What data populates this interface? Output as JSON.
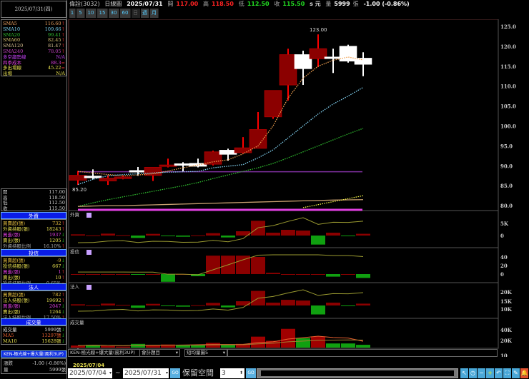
{
  "left": {
    "date": "2025/07/31(四)",
    "ma": [
      {
        "label": "SMA5",
        "value": "116.60",
        "color": "#e8a060",
        "arrow": "↑"
      },
      {
        "label": "SMA10",
        "value": "109.66",
        "color": "#7ad0f0",
        "arrow": "↑"
      },
      {
        "label": "SMA20",
        "value": "99.41",
        "color": "#30c030",
        "arrow": "↑"
      },
      {
        "label": "SMA60",
        "value": "82.45",
        "color": "#d8c070",
        "arrow": "↑"
      },
      {
        "label": "SMA120",
        "value": "81.47",
        "color": "#d8c090",
        "arrow": "↑"
      },
      {
        "label": "SMA240",
        "value": "78.05",
        "color": "#c040c0",
        "arrow": "↑"
      },
      {
        "label": "多空趨勢線",
        "value": "N/A",
        "color": "#c040f0",
        "arrow": ""
      },
      {
        "label": "四季成本",
        "value": "88.3",
        "color": "#e040e0",
        "arrow": "="
      },
      {
        "label": "多出場線",
        "value": "45.22",
        "color": "#e8e050",
        "arrow": "="
      },
      {
        "label": "出場",
        "value": "N/A",
        "color": "#e8e050",
        "arrow": ""
      }
    ],
    "ohlc": [
      {
        "label": "開",
        "value": "117.00"
      },
      {
        "label": "高",
        "value": "118.50"
      },
      {
        "label": "低",
        "value": "112.50"
      },
      {
        "label": "收",
        "value": "115.50"
      }
    ],
    "foreign": {
      "title": "外資",
      "rows": [
        {
          "label": "買賣超(張)",
          "value": "732",
          "color": "#e8c040",
          "arrow": "↑"
        },
        {
          "label": "外資持股(張)",
          "value": "18243",
          "color": "#e8e050",
          "arrow": "↑"
        },
        {
          "label": "買進(張)",
          "value": "1937",
          "color": "#e040e0",
          "arrow": "↓"
        },
        {
          "label": "賣出(張)",
          "value": "1205",
          "color": "#e8e050",
          "arrow": "↓"
        },
        {
          "label": "外資持股比例",
          "value": "16.10%",
          "color": "#aaa",
          "arrow": "↑"
        }
      ]
    },
    "trust": {
      "title": "投信",
      "rows": [
        {
          "label": "買賣超(張)",
          "value": "-9",
          "color": "#e8c040",
          "arrow": "↓"
        },
        {
          "label": "投信持股(張)",
          "value": "667",
          "color": "#e8e050",
          "arrow": "↓"
        },
        {
          "label": "買進(張)",
          "value": "1",
          "color": "#e040e0",
          "arrow": "↑"
        },
        {
          "label": "賣出(張)",
          "value": "10",
          "color": "#e8e050",
          "arrow": "↑"
        },
        {
          "label": "投信持股比例",
          "value": "0.65%",
          "color": "#aaa",
          "arrow": "="
        }
      ]
    },
    "inst": {
      "title": "法人",
      "rows": [
        {
          "label": "買賣超(張)",
          "value": "782",
          "color": "#e8c040",
          "arrow": "↑"
        },
        {
          "label": "法人持股(張)",
          "value": "19692",
          "color": "#e8e050",
          "arrow": "↑"
        },
        {
          "label": "買進(張)",
          "value": "2047",
          "color": "#e040e0",
          "arrow": "↓"
        },
        {
          "label": "賣出(張)",
          "value": "1264",
          "color": "#e8e050",
          "arrow": "↓"
        },
        {
          "label": "法人持股比例",
          "value": "17.50%",
          "color": "#aaa",
          "arrow": "↑"
        }
      ]
    },
    "volume": {
      "title": "成交量",
      "rows": [
        {
          "label": "成交量",
          "value": "5999張",
          "color": "#ddd",
          "arrow": "↓"
        },
        {
          "label": "MA5",
          "value": "13297張",
          "color": "#e86030",
          "arrow": "↓"
        },
        {
          "label": "MA10",
          "value": "15628張",
          "color": "#e8e050",
          "arrow": "↓"
        }
      ]
    },
    "indicator": "KEN-極光線+爆大量(風利3UP)",
    "change": {
      "label": "漲跌",
      "value": "-1.00 (-0.86%)"
    },
    "vol": {
      "label": "量",
      "value": "5999張"
    }
  },
  "header": {
    "name": "偉詮(3032)",
    "period": "日線圖",
    "date": "2025/07/31",
    "open_label": "開",
    "open": "117.00",
    "high_label": "高",
    "high": "118.50",
    "low_label": "低",
    "low": "112.50",
    "close_label": "收",
    "close": "115.50",
    "unit": "s 元",
    "vol_label": "量",
    "vol": "5999",
    "vol_unit": "張",
    "change": "-1.00 (-0.86%)"
  },
  "periods": [
    "1",
    "5",
    "10",
    "15",
    "30",
    "60",
    "日",
    "週",
    "月"
  ],
  "panels": {
    "foreign": "外資",
    "trust": "投信",
    "inst": "法人",
    "volume": "成交量"
  },
  "bottom": {
    "indicator": "KEN-極光線+爆大量(風利3UP)",
    "select2": "會計題目",
    "select3": "短均量圖5",
    "cursor_date": "2025/07/04",
    "start": "2025/07/04",
    "tilde": "~",
    "end": "2025/07/31",
    "go": "GO",
    "reserve_label": "保留空間",
    "reserve": "3"
  },
  "chart_data": [
    {
      "type": "candlestick",
      "ylim": [
        79,
        126
      ],
      "yticks": [
        80,
        85,
        90,
        95,
        100,
        105,
        110,
        115,
        120,
        125
      ],
      "annotations": [
        {
          "text": "123.00",
          "value": 123.0
        },
        {
          "text": "85.20",
          "value": 85.2
        }
      ],
      "ohlc": [
        [
          86.4,
          87.6,
          88.7,
          85.2
        ],
        [
          87.4,
          87.0,
          89.1,
          86.6
        ],
        [
          86.2,
          86.9,
          87.6,
          85.2
        ],
        [
          86.8,
          87.2,
          87.6,
          86.6
        ],
        [
          88.8,
          88.6,
          89.7,
          87.5
        ],
        [
          87.6,
          89.6,
          89.6,
          86.2
        ],
        [
          89.9,
          90.2,
          91.8,
          89.6
        ],
        [
          90.5,
          90.3,
          90.9,
          88.6
        ],
        [
          90.6,
          89.9,
          91.8,
          89.6
        ],
        [
          90.4,
          93.5,
          93.8,
          90.1
        ],
        [
          93.9,
          92.9,
          94.3,
          91.3
        ],
        [
          93.3,
          94.5,
          97.2,
          93.1
        ],
        [
          94.4,
          99.1,
          103.5,
          94.4
        ],
        [
          102.3,
          108.9,
          108.9,
          101.8
        ],
        [
          110.3,
          117.9,
          119.4,
          106.4
        ],
        [
          117.9,
          114.4,
          118.9,
          110.3
        ],
        [
          116.9,
          119.4,
          123.0,
          114.8
        ],
        [
          117.3,
          117.1,
          119.4,
          113.3
        ],
        [
          120.0,
          116.3,
          120.4,
          115.9
        ],
        [
          117.0,
          115.5,
          118.5,
          112.5
        ]
      ],
      "ma": [
        {
          "name": "SMA5",
          "color": "#f0a050",
          "values": [
            88.6,
            88.2,
            87.8,
            87.5,
            87.7,
            88.0,
            88.7,
            89.5,
            90.2,
            91.0,
            91.5,
            93.0,
            95.0,
            100.0,
            107.0,
            112.0,
            115.0,
            116.5,
            117.3,
            116.6
          ]
        },
        {
          "name": "SMA10",
          "color": "#80d0f0",
          "values": [
            85.3,
            86.6,
            87.5,
            87.8,
            88.0,
            88.2,
            88.4,
            88.5,
            88.6,
            89.5,
            89.9,
            90.3,
            92.0,
            94.0,
            97.0,
            100.0,
            103.0,
            105.5,
            107.5,
            109.7
          ]
        },
        {
          "name": "SMA20",
          "color": "#30c030",
          "values": [
            79.8,
            80.7,
            81.5,
            82.2,
            82.9,
            83.6,
            84.3,
            85.0,
            85.8,
            86.8,
            87.7,
            88.6,
            89.5,
            90.6,
            92.0,
            93.5,
            95.0,
            96.5,
            98.0,
            99.4
          ]
        },
        {
          "name": "SMA240",
          "color": "#c8a070",
          "values": [
            79.8,
            79.9,
            80.0,
            80.0,
            80.1,
            80.2,
            80.3,
            80.4,
            80.5,
            80.6,
            80.7,
            80.8,
            80.9,
            81.0,
            81.1,
            81.2,
            81.3,
            81.4,
            81.45,
            81.5
          ]
        }
      ],
      "flat_line": {
        "value": 88.5,
        "color": "#8030a0"
      }
    },
    {
      "type": "bar",
      "title": "外資",
      "unit": "K張",
      "yticks": [
        "5K",
        "0"
      ],
      "values": [
        0.5,
        0.1,
        0.8,
        0.2,
        -1.0,
        0.7,
        -0.1,
        -0.5,
        0.1,
        1.0,
        -0.8,
        1.8,
        6.2,
        1.2,
        2.4,
        2.1,
        -3.8,
        1.2,
        -0.1,
        0.73
      ]
    },
    {
      "type": "bar",
      "title": "投信",
      "unit": "張",
      "yticks": [
        "40",
        "20",
        "0"
      ],
      "values": [
        0,
        0,
        0,
        0,
        -1,
        0,
        -18,
        0,
        -5,
        43,
        43,
        43,
        40,
        3,
        0,
        0,
        0,
        -6,
        0,
        -9
      ]
    },
    {
      "type": "bar",
      "title": "法人",
      "unit": "K張",
      "yticks": [
        "20K",
        "15K",
        "10K"
      ],
      "values": [
        0.5,
        0.1,
        0.8,
        0.3,
        -1.0,
        0.7,
        -0.1,
        -0.5,
        0.1,
        1.1,
        -0.8,
        1.8,
        6.2,
        1.2,
        2.4,
        2.1,
        -3.8,
        1.2,
        -0.1,
        0.78
      ]
    },
    {
      "type": "bar",
      "title": "成交量",
      "unit": "K張",
      "yticks": [
        "40K",
        "20K",
        "10"
      ],
      "values": [
        4.4,
        5.8,
        3.6,
        2.2,
        8.0,
        5.8,
        6.7,
        4.9,
        5.8,
        10.2,
        5.8,
        8.0,
        23.6,
        14.7,
        40.4,
        20.4,
        24.0,
        8.9,
        8.9,
        6.0
      ]
    }
  ]
}
